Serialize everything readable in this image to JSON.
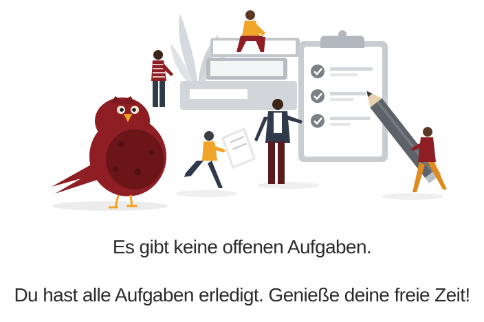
{
  "empty_state": {
    "headline": "Es gibt keine offenen Aufgaben.",
    "message": "Du hast alle Aufgaben erledigt. Genieße deine freie Zeit!",
    "illustration": {
      "mascot": "red-bird-icon",
      "clipboard": "checklist-clipboard-icon",
      "pencil": "pencil-icon",
      "books": "book-stack-icon",
      "plant": "plant-icon",
      "colors": {
        "mascot_red": "#8e1e24",
        "mascot_dark": "#6b1519",
        "beak_orange": "#f2a21f",
        "clipboard_gray": "#c9cdd2",
        "paper": "#ffffff",
        "check_gray": "#7b8087",
        "pencil_gray": "#5d6168",
        "light_gray": "#e4e6e9",
        "person_orange": "#f0a42a",
        "person_red": "#8e1e24",
        "person_dark": "#2f3a4a"
      }
    }
  }
}
